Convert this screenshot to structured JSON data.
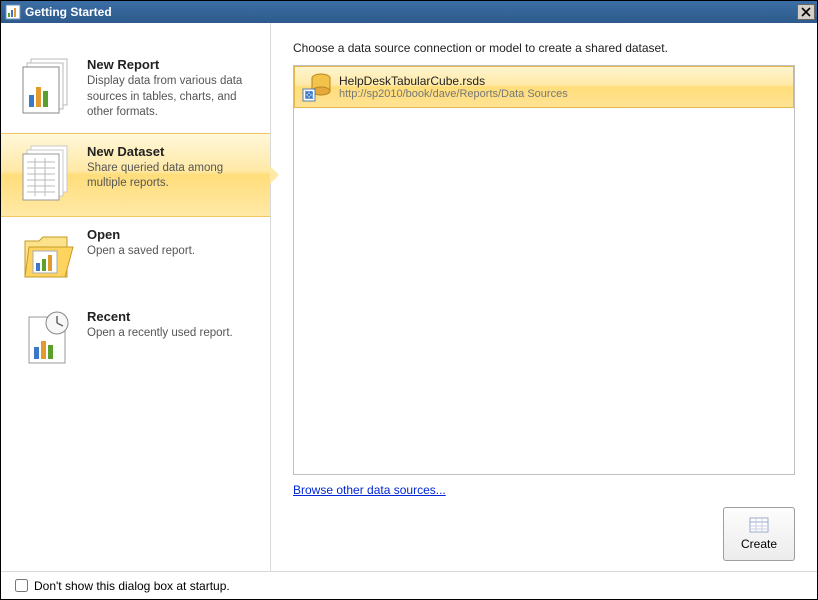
{
  "window": {
    "title": "Getting Started"
  },
  "sidebar": {
    "items": [
      {
        "title": "New Report",
        "desc": "Display data from various data sources in tables, charts, and other formats."
      },
      {
        "title": "New Dataset",
        "desc": "Share queried data among multiple reports."
      },
      {
        "title": "Open",
        "desc": "Open a saved report."
      },
      {
        "title": "Recent",
        "desc": "Open a recently used report."
      }
    ]
  },
  "main": {
    "heading": "Choose a data source connection or model to create a shared dataset.",
    "sources": [
      {
        "name": "HelpDeskTabularCube.rsds",
        "path": "http://sp2010/book/dave/Reports/Data Sources"
      }
    ],
    "browse_link": "Browse other data sources...",
    "create_label": "Create"
  },
  "footer": {
    "checkbox_label": "Don't show this dialog box at startup."
  }
}
